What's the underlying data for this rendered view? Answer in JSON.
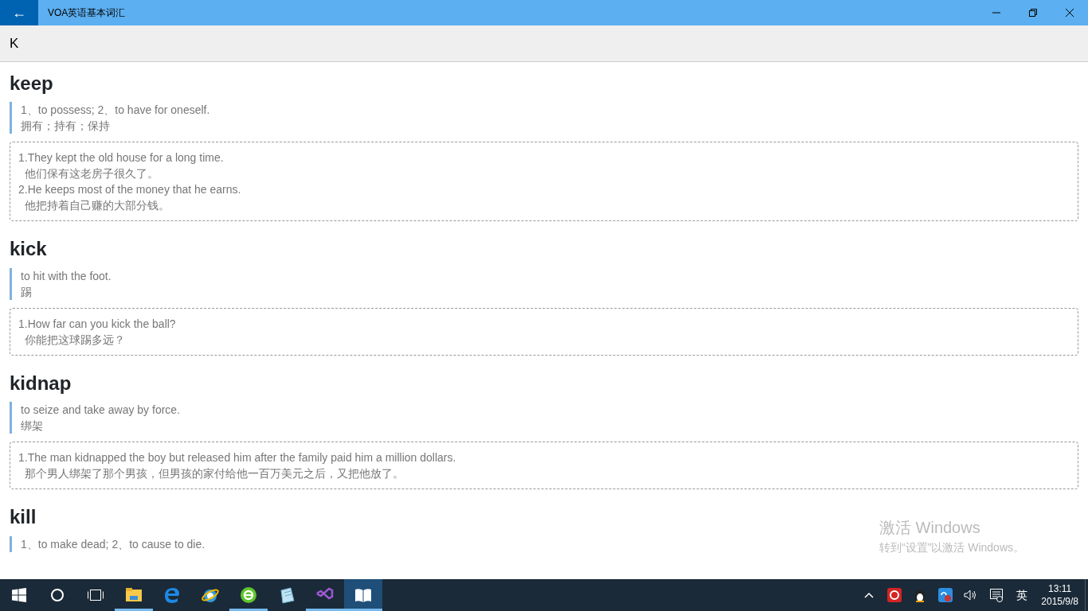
{
  "window": {
    "title": "VOA英语基本词汇",
    "back": "←"
  },
  "search": {
    "value": "K"
  },
  "entries": [
    {
      "word": "keep",
      "definition": {
        "english": "1、to possess; 2、to have for oneself.",
        "chinese": "拥有；持有；保持"
      },
      "examples": [
        {
          "sentence": "1.They kept the old house for a long time.",
          "translation": "他们保有这老房子很久了。"
        },
        {
          "sentence": "2.He keeps most of the money that he earns.",
          "translation": "他把持着自己赚的大部分钱。"
        }
      ]
    },
    {
      "word": "kick",
      "definition": {
        "english": "to hit with the foot.",
        "chinese": "踢"
      },
      "examples": [
        {
          "sentence": "1.How far can you kick the ball?",
          "translation": "你能把这球踢多远？"
        }
      ]
    },
    {
      "word": "kidnap",
      "definition": {
        "english": "to seize and take away by force.",
        "chinese": "绑架"
      },
      "examples": [
        {
          "sentence": "1.The man kidnapped the boy but released him after the family paid him a million dollars.",
          "translation": "那个男人绑架了那个男孩，但男孩的家付给他一百万美元之后，又把他放了。"
        }
      ]
    },
    {
      "word": "kill",
      "definition": {
        "english": "1、to make dead; 2、to cause to die."
      }
    }
  ],
  "activation": {
    "title": "激活 Windows",
    "message": "转到“设置”以激活 Windows。"
  },
  "taskbar": {
    "apps": [
      {
        "kind": "explorer",
        "running": true,
        "active": false
      },
      {
        "kind": "edge",
        "running": false,
        "active": false
      },
      {
        "kind": "ie",
        "running": false,
        "active": false
      },
      {
        "kind": "browser",
        "running": true,
        "active": false
      },
      {
        "kind": "notepad",
        "running": false,
        "active": false
      },
      {
        "kind": "studio",
        "running": true,
        "active": false
      },
      {
        "kind": "reader",
        "running": true,
        "active": true
      }
    ],
    "ime": "英",
    "time": "13:11",
    "date": "2015/9/8"
  }
}
